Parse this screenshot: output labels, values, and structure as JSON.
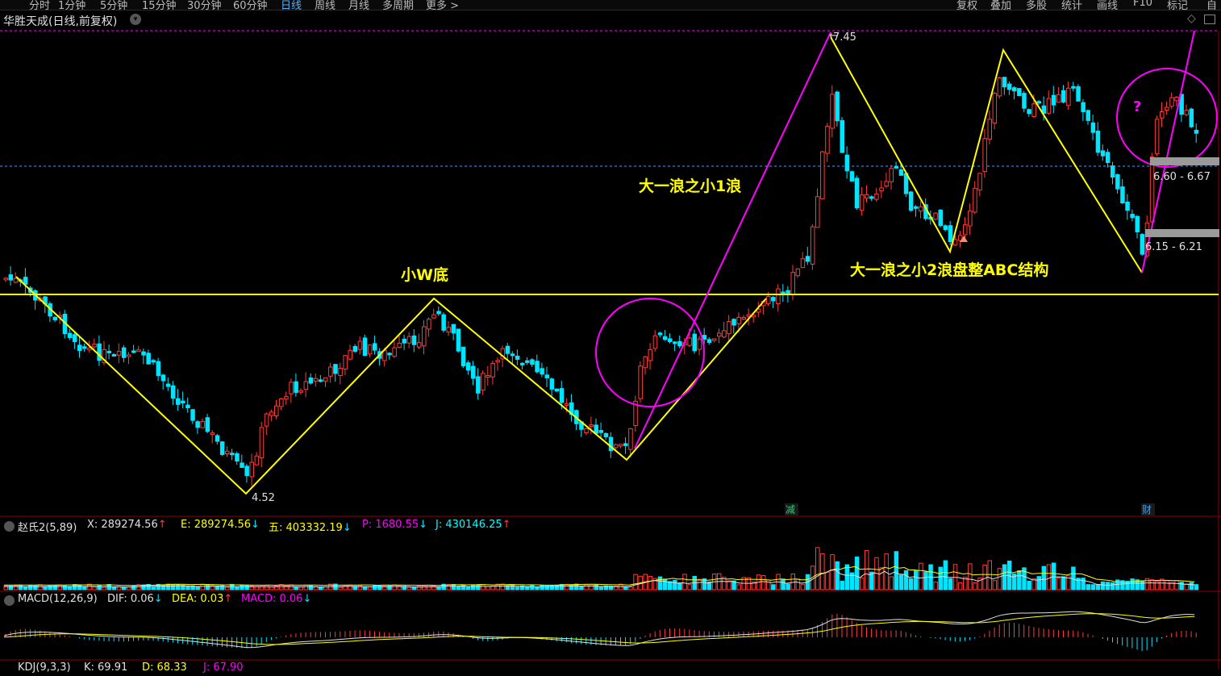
{
  "toolbar": {
    "periods": [
      "分时",
      "1分钟",
      "5分钟",
      "15分钟",
      "30分钟",
      "60分钟",
      "日线",
      "周线",
      "月线",
      "多周期",
      "更多 >"
    ],
    "active_period": "日线",
    "right_buttons": [
      "复权",
      "叠加",
      "多股",
      "统计",
      "画线",
      "F10",
      "标记",
      "自"
    ]
  },
  "title": "华胜天成(日线,前复权)",
  "price_labels": {
    "high": "7.45",
    "low": "4.52",
    "zone_upper": "6.60 - 6.67",
    "zone_lower": "6.15 - 6.21"
  },
  "annotations": {
    "wave1": "大一浪之小1浪",
    "w_bottom": "小W底",
    "wave2": "大一浪之小2浪盘整ABC结构",
    "question": "?"
  },
  "event_marks": {
    "reduce": "减",
    "finance": "财"
  },
  "volume_panel": {
    "name": "赵氏2(5,89)",
    "items": [
      {
        "label": "X: 289274.56",
        "arrow": "↑",
        "color": "#e0e0e0"
      },
      {
        "label": "E: 289274.56",
        "arrow": "↓",
        "color": "#ffff00"
      },
      {
        "label": "五: 403332.19",
        "arrow": "↓",
        "color": "#ffff00"
      },
      {
        "label": "P: 1680.55",
        "arrow": "↓",
        "color": "#ff00ff"
      },
      {
        "label": "J: 430146.25",
        "arrow": "↑",
        "color": "#00ffff"
      }
    ]
  },
  "macd_panel": {
    "name": "MACD(12,26,9)",
    "items": [
      {
        "label": "DIF: 0.06",
        "arrow": "↓",
        "color": "#e0e0e0"
      },
      {
        "label": "DEA: 0.03",
        "arrow": "↑",
        "color": "#ffff00"
      },
      {
        "label": "MACD: 0.06",
        "arrow": "↓",
        "color": "#ff00ff"
      }
    ]
  },
  "kdj_panel": {
    "name": "KDJ(9,3,3)",
    "items": [
      {
        "label": "K: 69.91",
        "color": "#e0e0e0"
      },
      {
        "label": "D: 68.33",
        "color": "#ffff00"
      },
      {
        "label": "J: 67.90",
        "color": "#ff00ff"
      }
    ]
  },
  "colors": {
    "up": "#ff3b3b",
    "down": "#00e5ff",
    "yellow": "#ffff00",
    "magenta": "#ff00ff"
  }
}
